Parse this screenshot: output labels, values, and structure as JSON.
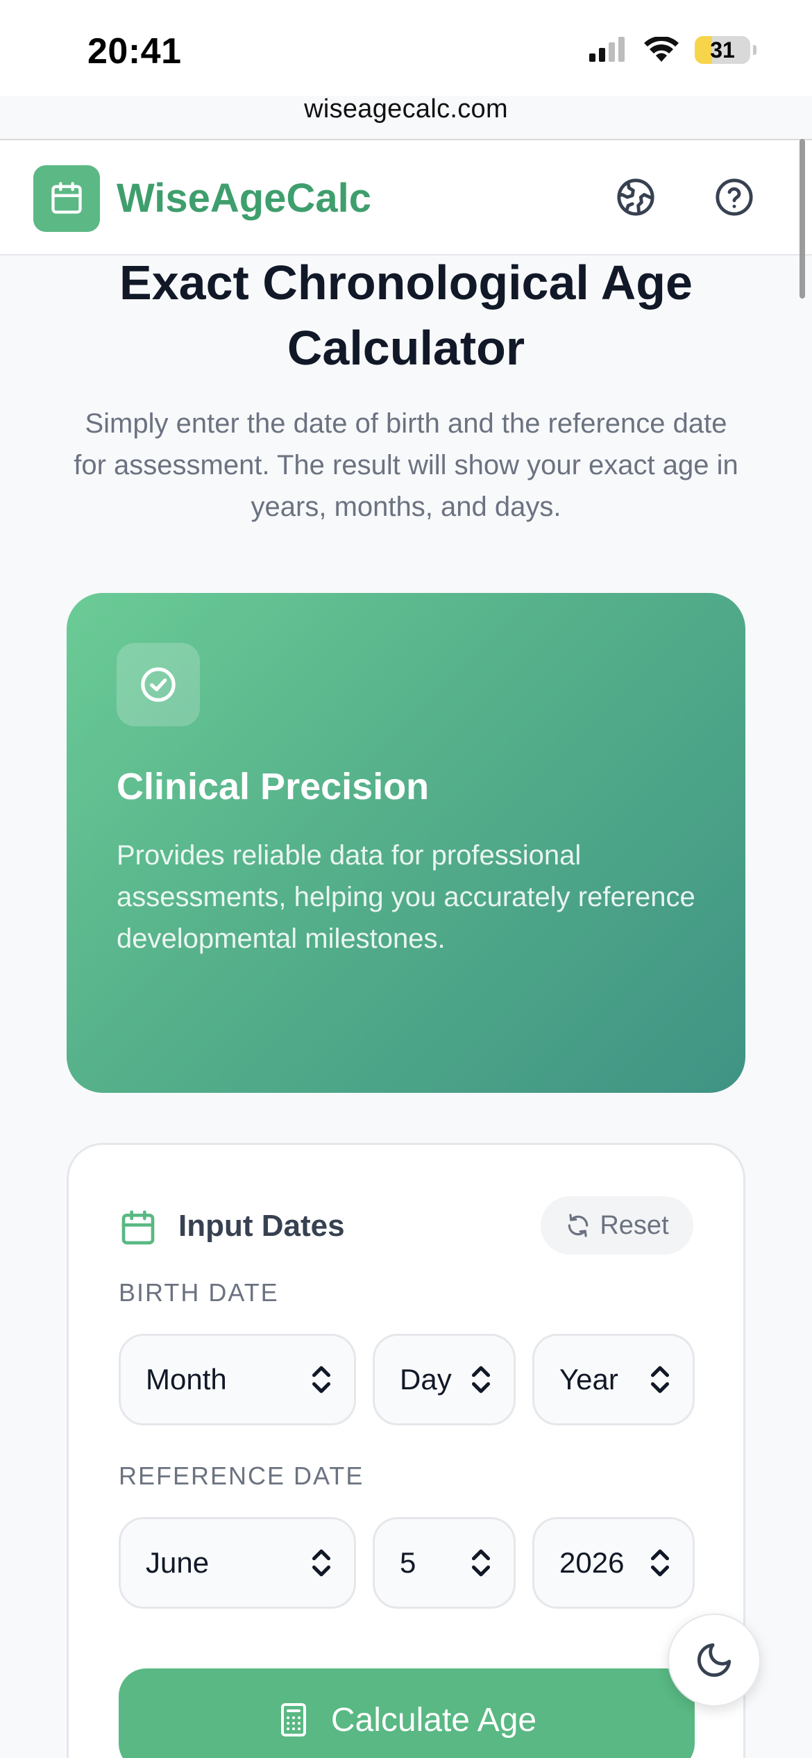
{
  "status_bar": {
    "time": "20:41",
    "battery": "31",
    "url": "wiseagecalc.com"
  },
  "header": {
    "brand": "WiseAgeCalc",
    "logo_icon": "calendar-icon",
    "language_icon": "globe-icon",
    "help_icon": "help-circle-icon",
    "brand_color": "#3f9e6d"
  },
  "hero": {
    "title": "Exact Chronological Age Calculator",
    "subtitle": "Simply enter the date of birth and the reference date for assessment. The result will show your exact age in years, months, and days."
  },
  "feature": {
    "icon": "check-circle-icon",
    "title": "Clinical Precision",
    "description": "Provides reliable data for professional assessments, helping you accurately reference developmental milestones."
  },
  "input_card": {
    "title": "Input Dates",
    "reset_label": "Reset",
    "birth_date": {
      "label": "BIRTH DATE",
      "month": "Month",
      "day": "Day",
      "year": "Year"
    },
    "reference_date": {
      "label": "REFERENCE DATE",
      "month": "June",
      "day": "5",
      "year": "2026"
    },
    "calculate_label": "Calculate Age"
  },
  "theme_toggle_icon": "moon-icon",
  "colors": {
    "accent": "#59b883",
    "card_gradient_start": "#6bcb96",
    "card_gradient_end": "#3f9384"
  }
}
